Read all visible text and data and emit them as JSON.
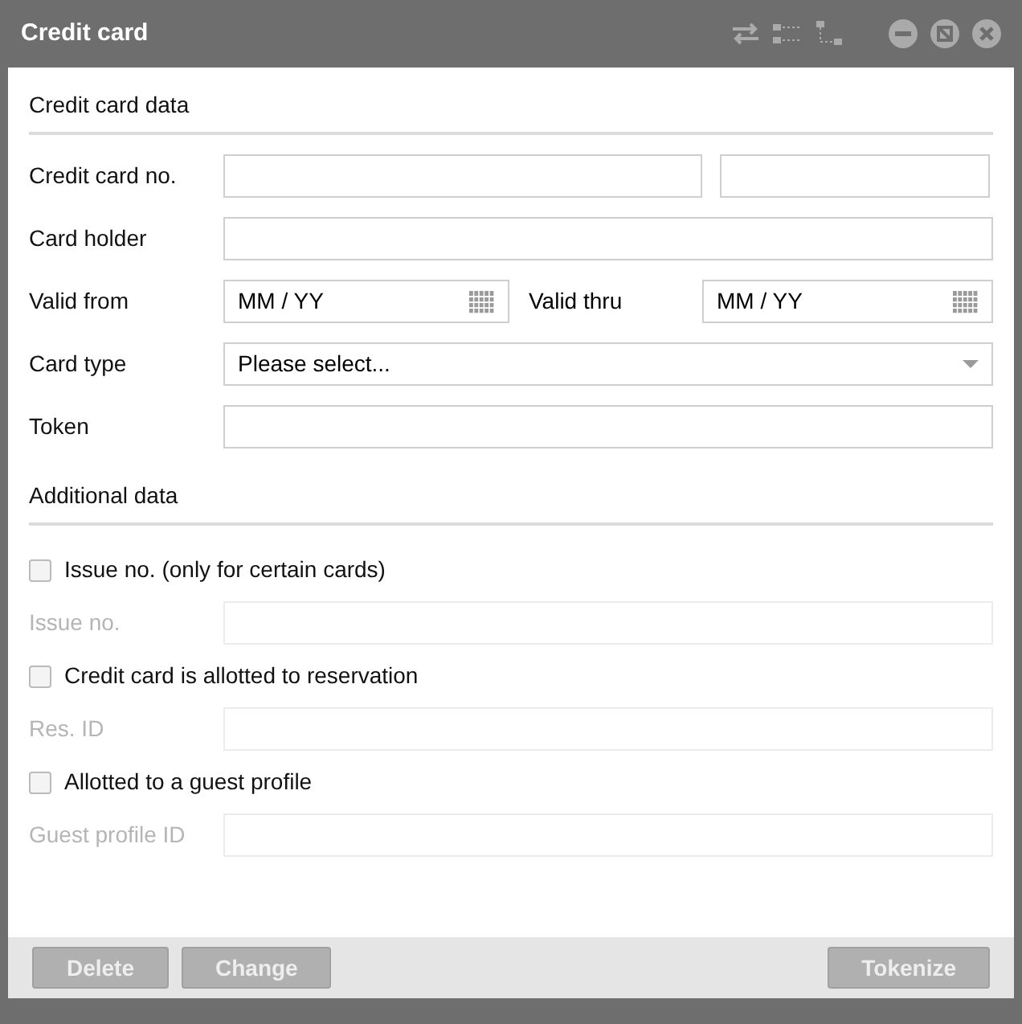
{
  "window": {
    "title": "Credit card"
  },
  "sections": [
    {
      "title": "Credit card data",
      "rows": [
        {
          "kind": "double",
          "label": "Credit card no.",
          "value": "",
          "second_value": ""
        },
        {
          "kind": "text",
          "label": "Card holder",
          "value": ""
        },
        {
          "kind": "dates",
          "label": "Valid from",
          "placeholder": "MM / YY",
          "second_label": "Valid thru",
          "second_placeholder": "MM / YY"
        },
        {
          "kind": "select",
          "label": "Card type",
          "placeholder": "Please select..."
        },
        {
          "kind": "text",
          "label": "Token",
          "value": ""
        }
      ]
    },
    {
      "title": "Additional data",
      "rows": [
        {
          "kind": "checkbox",
          "label": "Issue no. (only for certain cards)",
          "checked": false
        },
        {
          "kind": "text",
          "label": "Issue no.",
          "value": "",
          "disabled": true
        },
        {
          "kind": "checkbox",
          "label": "Credit card is allotted to reservation",
          "checked": false
        },
        {
          "kind": "text",
          "label": "Res. ID",
          "value": "",
          "disabled": true
        },
        {
          "kind": "checkbox",
          "label": "Allotted to a guest profile",
          "checked": false
        },
        {
          "kind": "text",
          "label": "Guest profile ID",
          "value": "",
          "disabled": true
        }
      ]
    }
  ],
  "buttons": {
    "left": [
      {
        "label": "Delete",
        "disabled": true
      },
      {
        "label": "Change",
        "disabled": true
      }
    ],
    "right": [
      {
        "label": "Tokenize",
        "disabled": true
      }
    ]
  }
}
